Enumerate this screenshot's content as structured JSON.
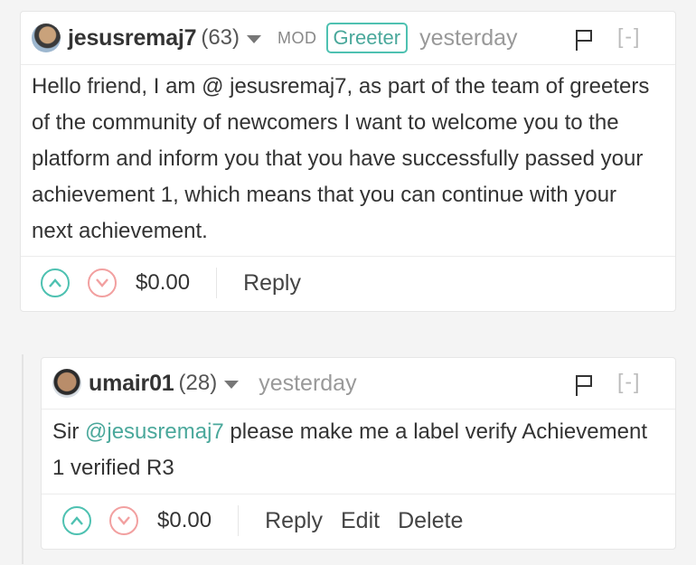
{
  "comment1": {
    "author": "jesusremaj7",
    "reputation": "(63)",
    "role_tag": "MOD",
    "badge": "Greeter",
    "time": "yesterday",
    "collapse": "[-]",
    "body": "Hello friend, I am @ jesusremaj7, as part of the team of greeters of the community of newcomers I want to welcome you to the platform and inform you that you have successfully passed your achievement 1, which means that you can continue with your next achievement.",
    "payout": "$0.00",
    "reply_label": "Reply"
  },
  "comment2": {
    "author": "umair01",
    "reputation": "(28)",
    "time": "yesterday",
    "collapse": "[-]",
    "body_prefix": "Sir ",
    "mention": "@jesusremaj7",
    "body_suffix": " please make me a label verify Achievement 1 verified R3",
    "payout": "$0.00",
    "reply_label": "Reply",
    "edit_label": "Edit",
    "delete_label": "Delete"
  },
  "colors": {
    "accent": "#4ec1b1",
    "downvote": "#f2a0a0",
    "muted": "#999999"
  }
}
